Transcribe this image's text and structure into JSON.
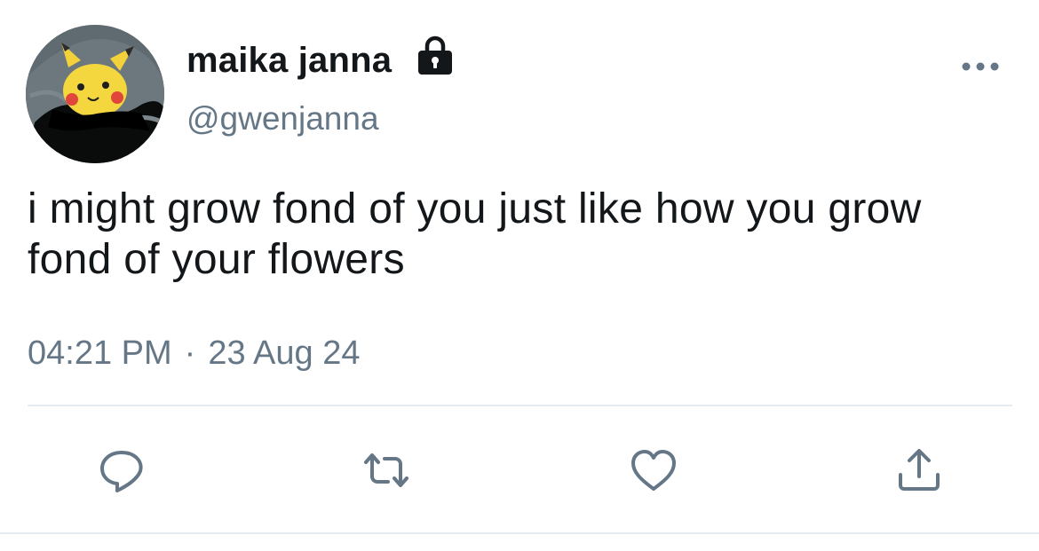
{
  "tweet": {
    "author": {
      "display_name": "maika janna",
      "handle": "@gwenjanna",
      "protected": true,
      "avatar_icon": "pikachu-plush-in-blanket"
    },
    "text": "i might grow fond of you just like how you grow fond of your flowers",
    "time": "04:21 PM",
    "separator": "·",
    "date": "23 Aug 24"
  },
  "icons": {
    "lock": "lock-icon",
    "more": "more-horizontal-icon",
    "reply": "reply-icon",
    "retweet": "retweet-icon",
    "like": "heart-icon",
    "share": "share-icon"
  },
  "colors": {
    "text": "#14171a",
    "secondary": "#657786",
    "divider": "#e6ecf0"
  }
}
